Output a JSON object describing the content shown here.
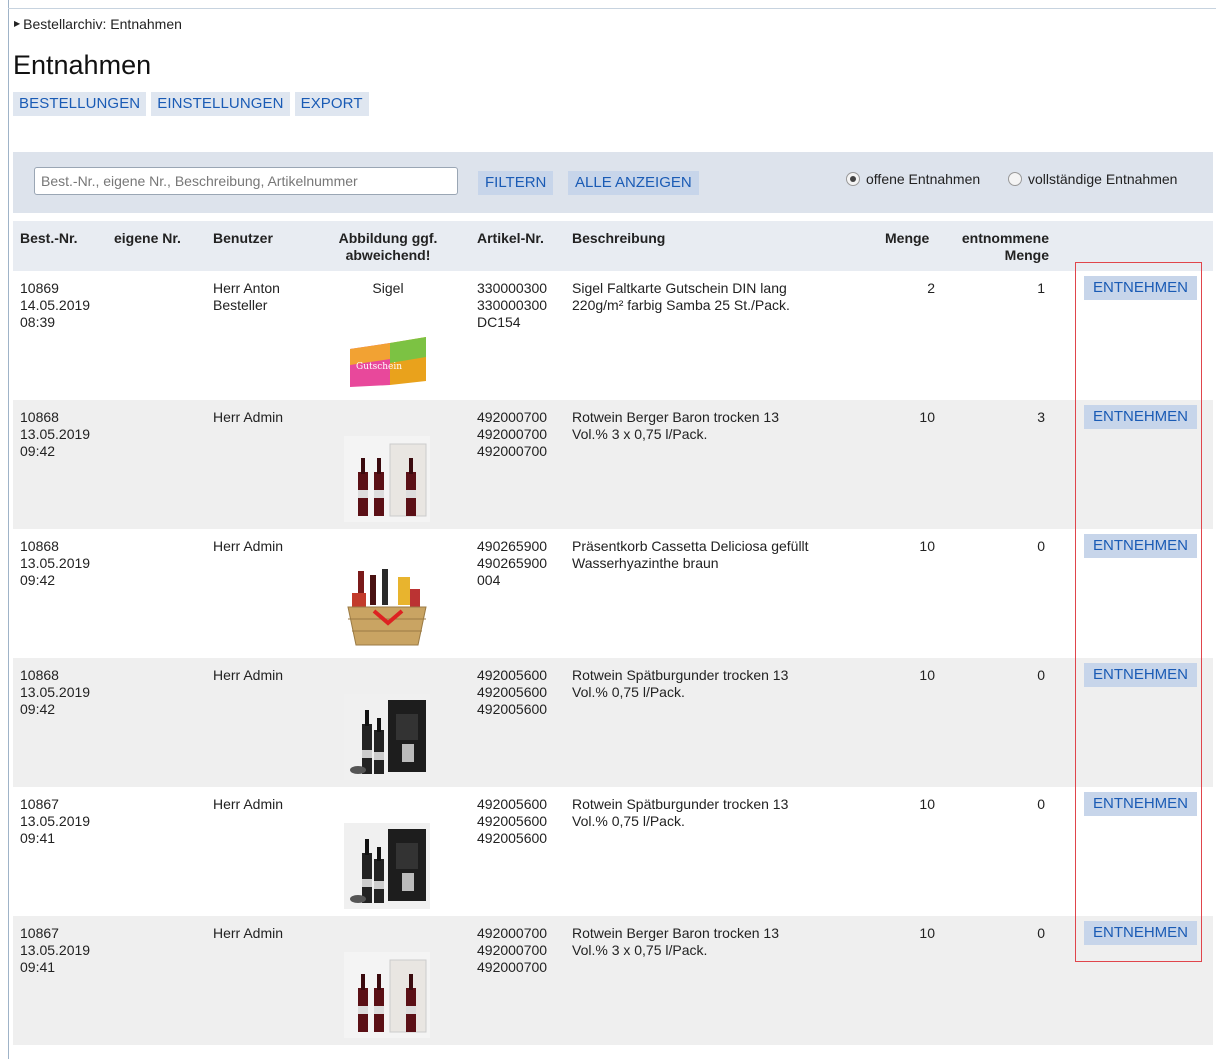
{
  "breadcrumb": "Bestellarchiv: Entnahmen",
  "page_title": "Entnahmen",
  "tabs": [
    "BESTELLUNGEN",
    "EINSTELLUNGEN",
    "EXPORT"
  ],
  "filter": {
    "placeholder": "Best.-Nr., eigene Nr., Beschreibung, Artikelnummer",
    "filter_label": "FILTERN",
    "show_all_label": "ALLE ANZEIGEN",
    "radio_open": "offene Entnahmen",
    "radio_complete": "vollständige Entnahmen",
    "selected": "offene Entnahmen"
  },
  "columns": {
    "order_no": "Best.-Nr.",
    "own_no": "eigene Nr.",
    "user": "Benutzer",
    "image_1": "Abbildung ggf.",
    "image_2": "abweichend!",
    "article_no": "Artikel-Nr.",
    "description": "Beschreibung",
    "quantity": "Menge",
    "taken_1": "entnommene",
    "taken_2": "Menge"
  },
  "rows": [
    {
      "order_no": "10869",
      "date": "14.05.2019",
      "time": "08:39",
      "user_1": "Herr Anton",
      "user_2": "Besteller",
      "brand": "Sigel",
      "art_1": "330000300",
      "art_2": "330000300",
      "art_3": "DC154",
      "desc_1": "Sigel Faltkarte Gutschein DIN lang",
      "desc_2": "220g/m² farbig Samba 25 St./Pack.",
      "qty": "2",
      "taken": "1",
      "action": "ENTNEHMEN",
      "image": "voucher-card-image"
    },
    {
      "order_no": "10868",
      "date": "13.05.2019",
      "time": "09:42",
      "user_1": "Herr Admin",
      "user_2": "",
      "brand": "",
      "art_1": "492000700",
      "art_2": "492000700",
      "art_3": "492000700",
      "desc_1": "Rotwein Berger Baron trocken 13",
      "desc_2": "Vol.% 3 x 0,75 l/Pack.",
      "qty": "10",
      "taken": "3",
      "action": "ENTNEHMEN",
      "image": "wine-bottles-box-image"
    },
    {
      "order_no": "10868",
      "date": "13.05.2019",
      "time": "09:42",
      "user_1": "Herr Admin",
      "user_2": "",
      "brand": "",
      "art_1": "490265900",
      "art_2": "490265900",
      "art_3": "004",
      "desc_1": "Präsentkorb Cassetta Deliciosa gefüllt",
      "desc_2": "Wasserhyazinthe braun",
      "qty": "10",
      "taken": "0",
      "action": "ENTNEHMEN",
      "image": "gift-basket-image"
    },
    {
      "order_no": "10868",
      "date": "13.05.2019",
      "time": "09:42",
      "user_1": "Herr Admin",
      "user_2": "",
      "brand": "",
      "art_1": "492005600",
      "art_2": "492005600",
      "art_3": "492005600",
      "desc_1": "Rotwein Spätburgunder trocken 13",
      "desc_2": "Vol.% 0,75 l/Pack.",
      "qty": "10",
      "taken": "0",
      "action": "ENTNEHMEN",
      "image": "dark-wine-box-image"
    },
    {
      "order_no": "10867",
      "date": "13.05.2019",
      "time": "09:41",
      "user_1": "Herr Admin",
      "user_2": "",
      "brand": "",
      "art_1": "492005600",
      "art_2": "492005600",
      "art_3": "492005600",
      "desc_1": "Rotwein Spätburgunder trocken 13",
      "desc_2": "Vol.% 0,75 l/Pack.",
      "qty": "10",
      "taken": "0",
      "action": "ENTNEHMEN",
      "image": "dark-wine-box-image"
    },
    {
      "order_no": "10867",
      "date": "13.05.2019",
      "time": "09:41",
      "user_1": "Herr Admin",
      "user_2": "",
      "brand": "",
      "art_1": "492000700",
      "art_2": "492000700",
      "art_3": "492000700",
      "desc_1": "Rotwein Berger Baron trocken 13",
      "desc_2": "Vol.% 3 x 0,75 l/Pack.",
      "qty": "10",
      "taken": "0",
      "action": "ENTNEHMEN",
      "image": "wine-bottles-box-image"
    }
  ],
  "colors": {
    "accent": "#1a5bb5",
    "button_bg": "#c7d5ea",
    "highlight": "#e0454b",
    "header_bg": "#dde3ec"
  }
}
